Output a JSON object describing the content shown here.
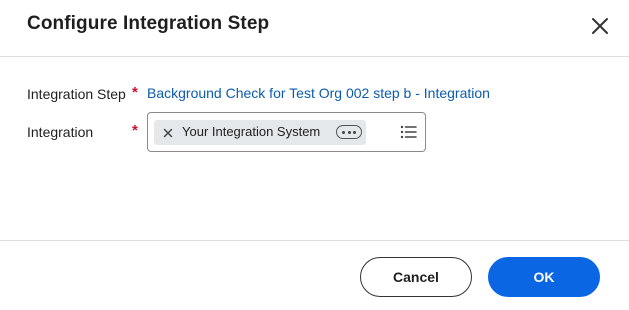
{
  "dialog": {
    "title": "Configure Integration Step",
    "close_icon": "close-icon"
  },
  "form": {
    "integration_step": {
      "label": "Integration Step",
      "required_marker": "*",
      "value": "Background Check for Test Org 002 step b - Integration"
    },
    "integration": {
      "label": "Integration",
      "required_marker": "*",
      "selected_value": "Your Integration System",
      "remove_icon": "x-icon",
      "more_icon": "ellipsis-icon",
      "prompt_icon": "list-icon"
    }
  },
  "footer": {
    "cancel_label": "Cancel",
    "ok_label": "OK"
  },
  "colors": {
    "link": "#0b5cad",
    "required": "#c8102e",
    "primary": "#0b66e4"
  }
}
